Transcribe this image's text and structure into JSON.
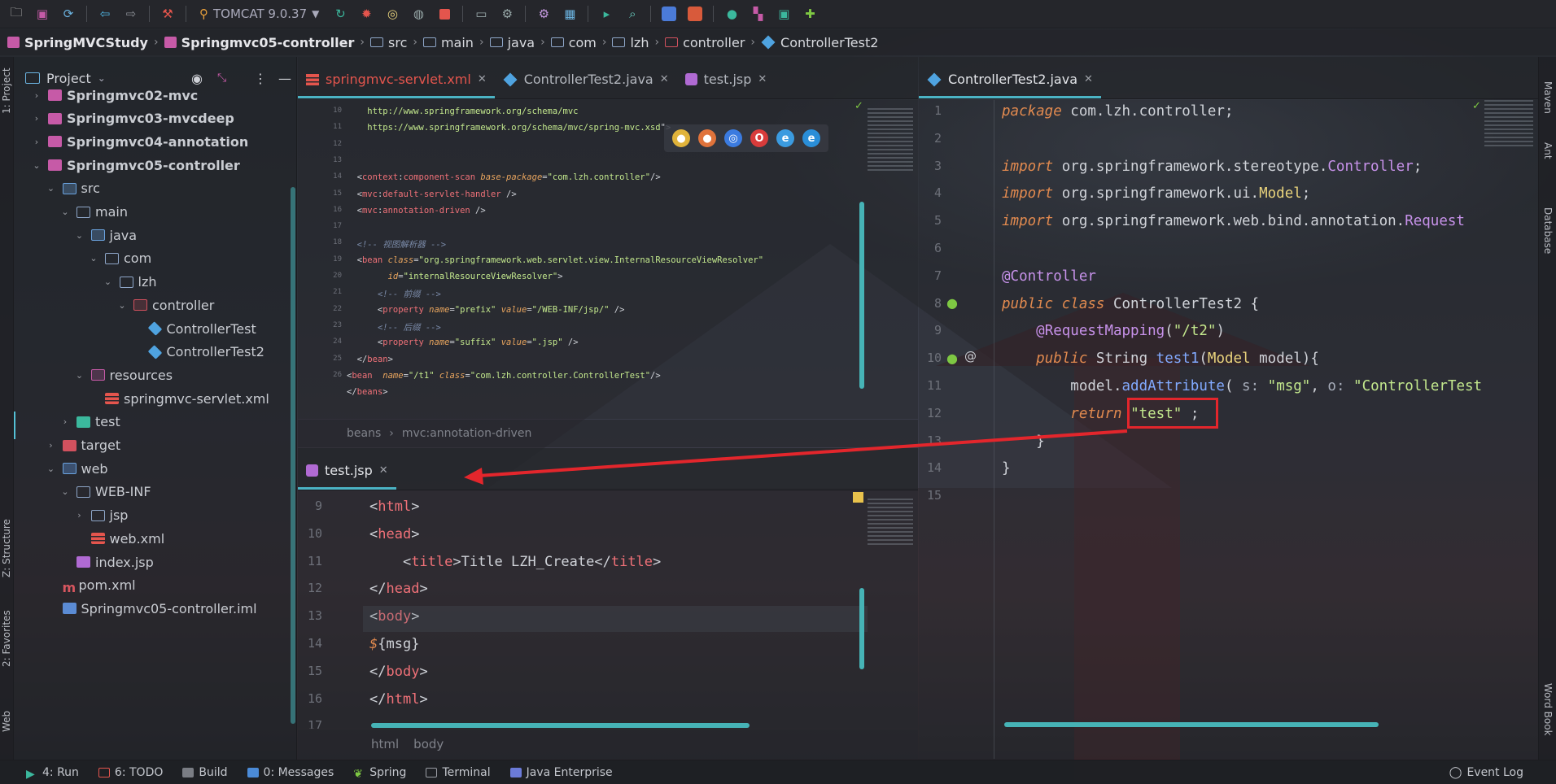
{
  "toolbar": {
    "run_config": "TOMCAT 9.0.37"
  },
  "breadcrumb": [
    {
      "label": "SpringMVCStudy",
      "kind": "mod",
      "bold": true
    },
    {
      "label": "Springmvc05-controller",
      "kind": "mod",
      "bold": true
    },
    {
      "label": "src",
      "kind": "folder"
    },
    {
      "label": "main",
      "kind": "folder"
    },
    {
      "label": "java",
      "kind": "folder"
    },
    {
      "label": "com",
      "kind": "folder"
    },
    {
      "label": "lzh",
      "kind": "folder"
    },
    {
      "label": "controller",
      "kind": "ctrl"
    },
    {
      "label": "ControllerTest2",
      "kind": "class"
    }
  ],
  "left_stripe": {
    "project": "1: Project",
    "structure": "Z: Structure",
    "favorites": "2: Favorites",
    "web": "Web"
  },
  "right_stripe": {
    "maven": "Maven",
    "ant": "Ant",
    "database": "Database",
    "word_book": "Word Book"
  },
  "project_panel": {
    "title": "Project",
    "items": [
      {
        "label": "Springmvc02-mvc",
        "depth": 0,
        "arrow": "›",
        "icon": "ic-mod",
        "bold": true
      },
      {
        "label": "Springmvc03-mvcdeep",
        "depth": 0,
        "arrow": "›",
        "icon": "ic-mod",
        "bold": true
      },
      {
        "label": "Springmvc04-annotation",
        "depth": 0,
        "arrow": "›",
        "icon": "ic-mod",
        "bold": true
      },
      {
        "label": "Springmvc05-controller",
        "depth": 0,
        "arrow": "⌄",
        "icon": "ic-mod",
        "bold": true
      },
      {
        "label": "src",
        "depth": 1,
        "arrow": "⌄",
        "icon": "ic-src"
      },
      {
        "label": "main",
        "depth": 2,
        "arrow": "⌄",
        "icon": "ic-folder"
      },
      {
        "label": "java",
        "depth": 3,
        "arrow": "⌄",
        "icon": "ic-src"
      },
      {
        "label": "com",
        "depth": 4,
        "arrow": "⌄",
        "icon": "ic-folder"
      },
      {
        "label": "lzh",
        "depth": 5,
        "arrow": "⌄",
        "icon": "ic-folder"
      },
      {
        "label": "controller",
        "depth": 6,
        "arrow": "⌄",
        "icon": "ic-ctrl"
      },
      {
        "label": "ControllerTest",
        "depth": 7,
        "arrow": "",
        "icon": "ic-class"
      },
      {
        "label": "ControllerTest2",
        "depth": 7,
        "arrow": "",
        "icon": "ic-class"
      },
      {
        "label": "resources",
        "depth": 3,
        "arrow": "⌄",
        "icon": "ic-res"
      },
      {
        "label": "springmvc-servlet.xml",
        "depth": 4,
        "arrow": "",
        "icon": "ic-xml"
      },
      {
        "label": "test",
        "depth": 2,
        "arrow": "›",
        "icon": "ic-test"
      },
      {
        "label": "target",
        "depth": 1,
        "arrow": "›",
        "icon": "ic-target"
      },
      {
        "label": "web",
        "depth": 1,
        "arrow": "⌄",
        "icon": "ic-web"
      },
      {
        "label": "WEB-INF",
        "depth": 2,
        "arrow": "⌄",
        "icon": "ic-folder"
      },
      {
        "label": "jsp",
        "depth": 3,
        "arrow": "›",
        "icon": "ic-folder"
      },
      {
        "label": "web.xml",
        "depth": 3,
        "arrow": "",
        "icon": "ic-xml"
      },
      {
        "label": "index.jsp",
        "depth": 2,
        "arrow": "",
        "icon": "ic-jsp"
      },
      {
        "label": "pom.xml",
        "depth": 1,
        "arrow": "",
        "icon": "ic-pom"
      },
      {
        "label": "Springmvc05-controller.iml",
        "depth": 1,
        "arrow": "",
        "icon": "ic-iml"
      }
    ]
  },
  "left_tabs": [
    {
      "label": "springmvc-servlet.xml",
      "icon": "xml",
      "active": true
    },
    {
      "label": "ControllerTest2.java",
      "icon": "java",
      "active": false
    },
    {
      "label": "test.jsp",
      "icon": "jsp",
      "active": false
    }
  ],
  "right_tabs": [
    {
      "label": "ControllerTest2.java",
      "icon": "java",
      "active": true
    }
  ],
  "bottom_tabs": [
    {
      "label": "test.jsp",
      "icon": "jsp",
      "active": true
    }
  ],
  "xml_editor": {
    "lines": [
      {
        "n": "10",
        "html": "    <span class=\"val\">http://www.springframework.org/schema/mvc</span>"
      },
      {
        "n": "11",
        "html": "    <span class=\"val\">https://www.springframework.org/schema/mvc/spring-mvc.xsd</span>\">"
      },
      {
        "n": "12",
        "html": ""
      },
      {
        "n": "13",
        "html": ""
      },
      {
        "n": "14",
        "html": "  &lt;<span class=\"tag\">context</span>:<span class=\"tag\">component-scan</span> <span class=\"attr\">base-package</span>=<span class=\"val\">\"com.lzh.controller\"</span>/&gt;"
      },
      {
        "n": "15",
        "html": "  &lt;<span class=\"tag\">mvc</span>:<span class=\"tag\">default-servlet-handler</span> /&gt;"
      },
      {
        "n": "16",
        "html": "  &lt;<span class=\"tag\">mvc</span>:<span class=\"tag\">annotation-driven</span> /&gt;"
      },
      {
        "n": "17",
        "html": ""
      },
      {
        "n": "18",
        "html": "  <span class=\"cm\">&lt;!-- 视图解析器 --&gt;</span>"
      },
      {
        "n": "19",
        "html": "  &lt;<span class=\"tag\">bean</span> <span class=\"attr\">class</span>=<span class=\"val\">\"org.springframework.web.servlet.view.InternalResourceViewResolver\"</span>"
      },
      {
        "n": "20",
        "html": "        <span class=\"attr\">id</span>=<span class=\"val\">\"internalResourceViewResolver\"</span>&gt;"
      },
      {
        "n": "21",
        "html": "      <span class=\"cm\">&lt;!-- 前缀 --&gt;</span>"
      },
      {
        "n": "22",
        "html": "      &lt;<span class=\"tag\">property</span> <span class=\"attr\">name</span>=<span class=\"val\">\"prefix\"</span> <span class=\"attr\">value</span>=<span class=\"val\">\"/WEB-INF/jsp/\"</span> /&gt;"
      },
      {
        "n": "23",
        "html": "      <span class=\"cm\">&lt;!-- 后缀 --&gt;</span>"
      },
      {
        "n": "24",
        "html": "      &lt;<span class=\"tag\">property</span> <span class=\"attr\">name</span>=<span class=\"val\">\"suffix\"</span> <span class=\"attr\">value</span>=<span class=\"val\">\".jsp\"</span> /&gt;"
      },
      {
        "n": "25",
        "html": "  &lt;/<span class=\"tag\">bean</span>&gt;"
      },
      {
        "n": "26",
        "html": "&lt;<span class=\"tag\">bean</span>  <span class=\"attr\">name</span>=<span class=\"val\">\"/t1\"</span> <span class=\"attr\">class</span>=<span class=\"val\">\"com.lzh.controller.ControllerTest\"</span>/&gt;"
      },
      {
        "n": "",
        "html": "&lt;/<span class=\"tag\">beans</span>&gt;"
      }
    ],
    "breadcrumb_bean": "beans",
    "breadcrumb_tag": "mvc:annotation-driven"
  },
  "jsp_editor": {
    "lines": [
      {
        "n": "9",
        "html": "&lt;<span class=\"tag\">html</span>&gt;"
      },
      {
        "n": "10",
        "html": "&lt;<span class=\"tag\">head</span>&gt;"
      },
      {
        "n": "11",
        "html": "    &lt;<span class=\"tag\">title</span>&gt;Title LZH_Create&lt;/<span class=\"tag\">title</span>&gt;"
      },
      {
        "n": "12",
        "html": "&lt;/<span class=\"tag\">head</span>&gt;"
      },
      {
        "n": "13",
        "html": "&lt;<span class=\"tag\">body</span>&gt;"
      },
      {
        "n": "14",
        "html": "<span class=\"kw\">$</span>{msg}"
      },
      {
        "n": "15",
        "html": "&lt;/<span class=\"tag\">body</span>&gt;"
      },
      {
        "n": "16",
        "html": "&lt;/<span class=\"tag\">html</span>&gt;"
      },
      {
        "n": "17",
        "html": ""
      }
    ],
    "breadcrumb_html": "html",
    "breadcrumb_body": "body"
  },
  "java_editor": {
    "lines": [
      {
        "n": "1",
        "html": "<span class=\"k\">package</span> com.lzh.controller;"
      },
      {
        "n": "2",
        "html": ""
      },
      {
        "n": "3",
        "html": "<span class=\"k\">import</span> org.springframework.stereotype.<span class=\"ann\">Controller</span>;"
      },
      {
        "n": "4",
        "html": "<span class=\"k\">import</span> org.springframework.ui.<span class=\"ty\">Model</span>;"
      },
      {
        "n": "5",
        "html": "<span class=\"k\">import</span> org.springframework.web.bind.annotation.<span class=\"ann\">Request</span>"
      },
      {
        "n": "6",
        "html": ""
      },
      {
        "n": "7",
        "html": "<span class=\"ann\">@Controller</span>"
      },
      {
        "n": "8",
        "html": "<span class=\"k\">public class</span> ControllerTest2 {"
      },
      {
        "n": "9",
        "html": "    <span class=\"ann\">@RequestMapping</span>(<span class=\"str\">\"/t2\"</span>)"
      },
      {
        "n": "10",
        "html": "    <span class=\"k\">public</span> String <span class=\"fn\">test1</span>(<span class=\"ty\">Model</span> model){"
      },
      {
        "n": "11",
        "html": "        model.<span class=\"fn\">addAttribute</span>( <span class=\"prm\">s:</span> <span class=\"str\">\"msg\"</span>, <span class=\"prm\">o:</span> <span class=\"str\">\"ControllerTest</span>"
      },
      {
        "n": "12",
        "html": "        <span class=\"k\">return</span> <span class=\"str\">\"test\"</span> ;"
      },
      {
        "n": "13",
        "html": "    }"
      },
      {
        "n": "14",
        "html": "}"
      },
      {
        "n": "15",
        "html": ""
      }
    ]
  },
  "status_bar": {
    "run": "4: Run",
    "todo": "6: TODO",
    "build": "Build",
    "messages": "0: Messages",
    "spring": "Spring",
    "terminal": "Terminal",
    "java_enterprise": "Java Enterprise",
    "event_log": "Event Log"
  },
  "colors": {
    "accent": "#4bb3c4",
    "annotation_red": "#e3262c"
  }
}
